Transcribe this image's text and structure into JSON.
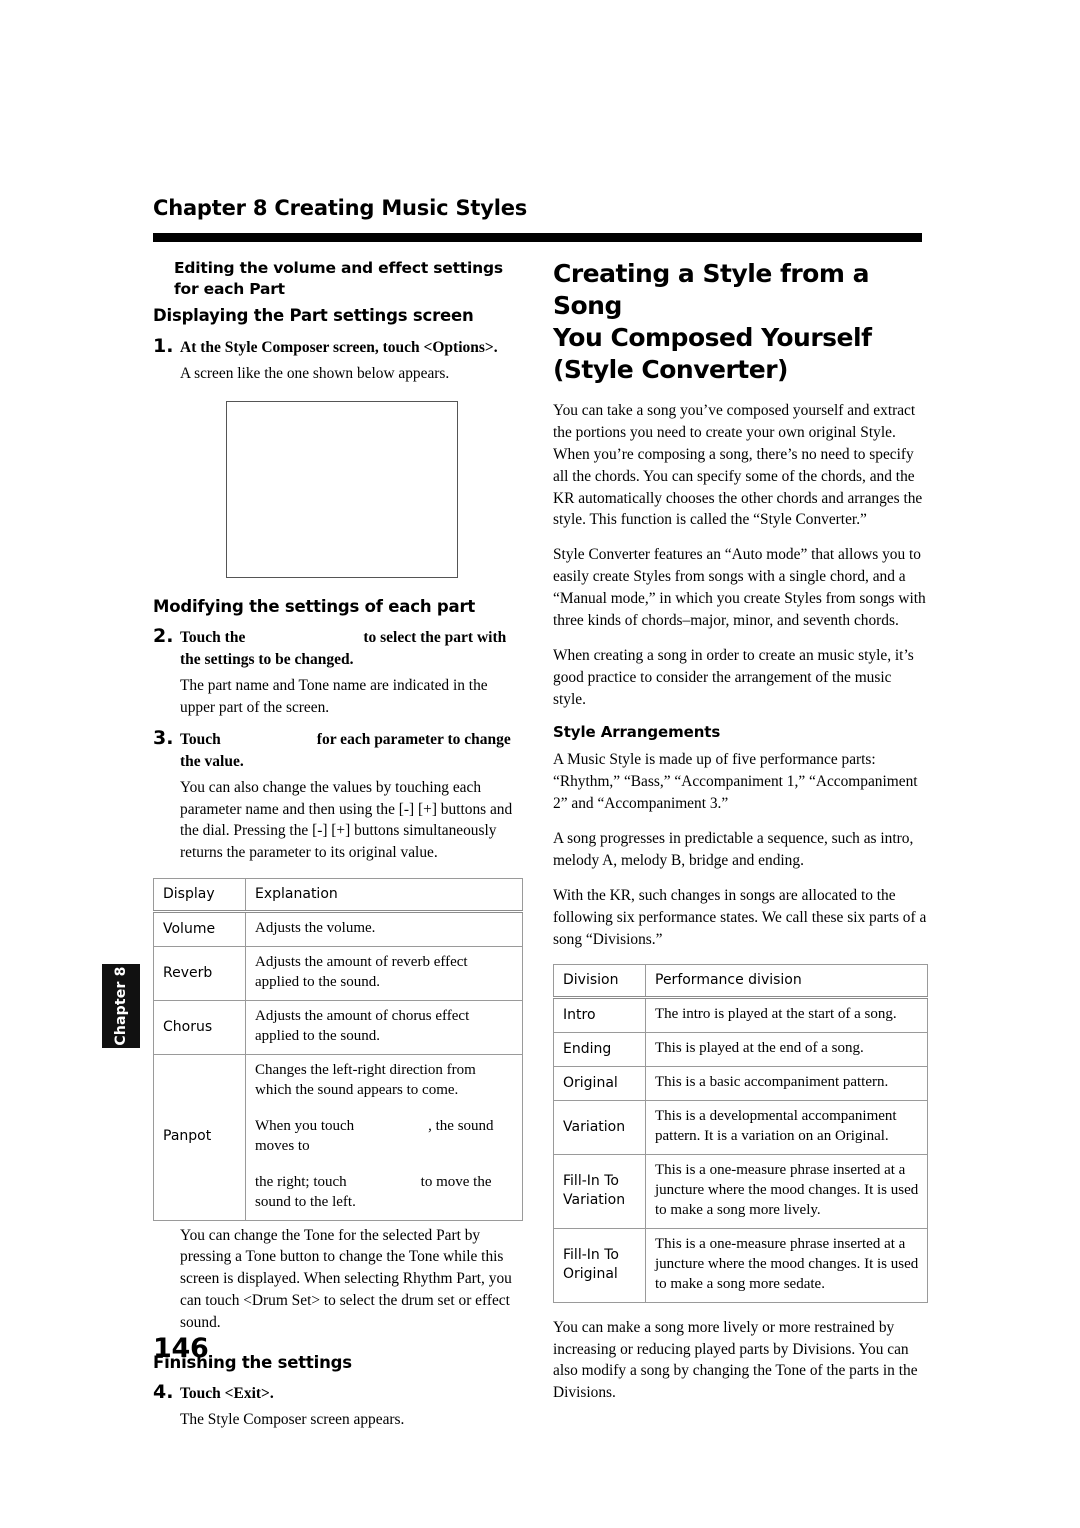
{
  "running_head": "Chapter 8 Creating Music Styles",
  "chapter_tab": "Chapter 8",
  "page_number": "146",
  "left_column": {
    "section_heading": "Editing the volume and effect settings for each Part",
    "sub_heading_1": "Displaying the Part settings screen",
    "step1": {
      "number": "1.",
      "title": "At the Style Composer screen, touch <Options>.",
      "body": "A screen like the one shown below appears."
    },
    "screenshot_caption": "",
    "sub_heading_2": "Modifying the settings of each part",
    "step2": {
      "number": "2.",
      "title_before": "Touch the",
      "title_after": "to select the part with the settings to be changed.",
      "body": "The part name and Tone name are indicated in the upper part of the screen."
    },
    "step3": {
      "number": "3.",
      "title_before": "Touch",
      "title_after": "for each parameter to change the value.",
      "body": "You can also change the values by touching each parameter name and then using the [-] [+] buttons and the dial. Pressing the [-] [+] buttons simultaneously returns the parameter to its original value."
    },
    "table": {
      "headers": [
        "Display",
        "Explanation"
      ],
      "rows": [
        {
          "key": "Volume",
          "value": "Adjusts the volume."
        },
        {
          "key": "Reverb",
          "value": "Adjusts the amount of reverb effect applied to the sound."
        },
        {
          "key": "Chorus",
          "value": "Adjusts the amount of chorus effect applied to the sound."
        }
      ],
      "panpot": {
        "key": "Panpot",
        "line1": "Changes the left-right direction from which the sound appears to come.",
        "line2_before": "When you touch",
        "line2_after": ", the sound moves to",
        "line3_before": "the right; touch",
        "line3_after": "to move the sound to the left."
      }
    },
    "after_table_body": "You can change the Tone for the selected Part by pressing a Tone button to change the Tone while this screen is displayed. When selecting Rhythm Part, you can touch <Drum Set> to select the drum set or effect sound.",
    "sub_heading_3": "Finishing the settings",
    "step4": {
      "number": "4.",
      "title": "Touch <Exit>.",
      "body": "The Style Composer screen appears."
    }
  },
  "right_column": {
    "title_line1": "Creating a Style from a Song",
    "title_line2": "You Composed Yourself",
    "title_line3": "(Style Converter)",
    "intro_p1": "You can take a song you’ve composed yourself and extract the portions you need to create your own original Style. When you’re composing a song, there’s no need to specify all the chords. You can specify some of the chords, and the KR automatically chooses the other chords and arranges the style. This function is called the “Style Converter.”",
    "intro_p2": "Style Converter features an “Auto mode” that allows you to easily create Styles from songs with a single chord, and a “Manual mode,” in which you create Styles from songs with three kinds of chords–major, minor, and seventh chords.",
    "intro_p3": "When creating a song in order to create an music style, it’s good practice to consider the arrangement of the music style.",
    "arrangements_heading": "Style Arrangements",
    "arr_p1": "A Music Style is made up of five performance parts: “Rhythm,” “Bass,” “Accompaniment 1,” “Accompaniment 2” and “Accompaniment 3.”",
    "arr_p2": "A song progresses in predictable a sequence, such as intro, melody A, melody B, bridge and ending.",
    "arr_p3": "With the KR, such changes in songs are allocated to the following six performance states. We call these six parts of a song “Divisions.”",
    "table": {
      "headers": [
        "Division",
        "Performance division"
      ],
      "rows": [
        {
          "key": "Intro",
          "value": "The intro is played at the start of a song."
        },
        {
          "key": "Ending",
          "value": "This is played at the end of a song."
        },
        {
          "key": "Original",
          "value": "This is a basic accompaniment pattern."
        },
        {
          "key": "Variation",
          "value": "This is a developmental accompaniment pattern. It is a variation on an Original."
        },
        {
          "key": "Fill-In To Variation",
          "value": "This is a one-measure phrase inserted at a juncture where the mood changes. It is used to make a song more lively."
        },
        {
          "key": "Fill-In To Original",
          "value": "This is a one-measure phrase inserted at a juncture where the mood changes. It is used to make a song more sedate."
        }
      ]
    },
    "closing_p": "You can make a song more lively or more restrained by increasing or reducing played parts by Divisions. You can also modify a song by changing the Tone of the parts in the Divisions."
  }
}
